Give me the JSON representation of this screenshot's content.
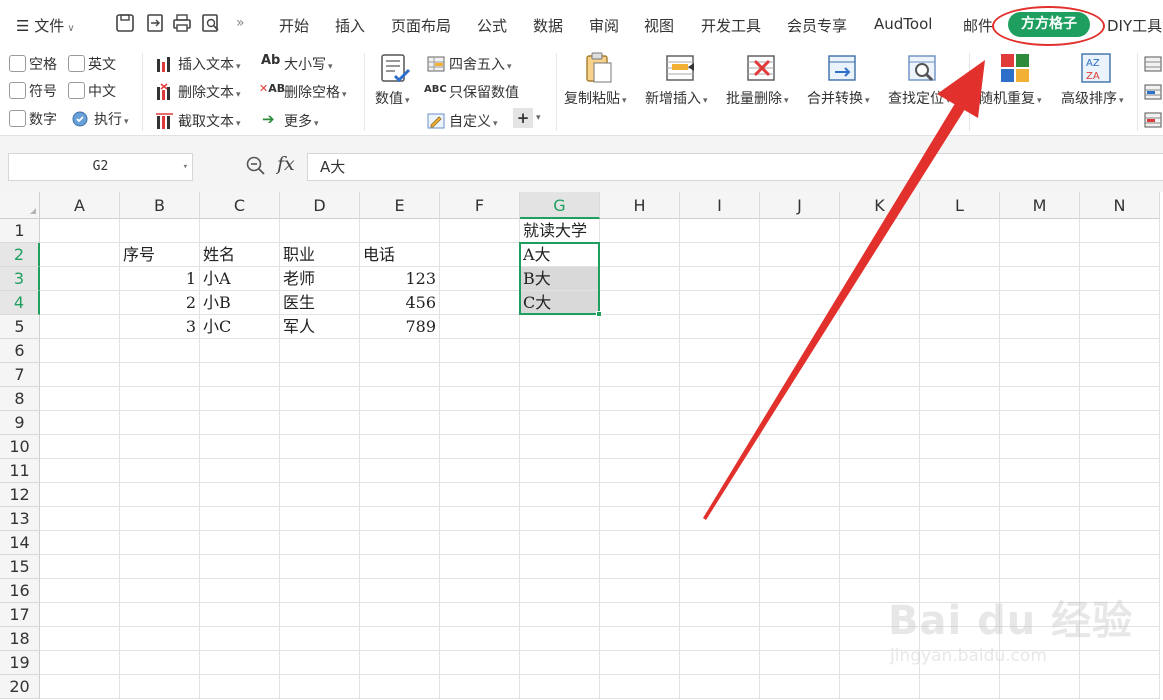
{
  "menu": {
    "file_label": "文件",
    "tabs": [
      "开始",
      "插入",
      "页面布局",
      "公式",
      "数据",
      "审阅",
      "视图",
      "开发工具",
      "会员专享",
      "AudTool",
      "邮件",
      "方方格子",
      "DIY工具箱"
    ],
    "active_tab": "方方格子"
  },
  "ribbon": {
    "checkboxes": [
      "空格",
      "英文",
      "符号",
      "中文",
      "数字"
    ],
    "exec_label": "执行",
    "text_tools": [
      "插入文本",
      "删除文本",
      "截取文本"
    ],
    "case_tools": [
      "大小写",
      "删除空格",
      "更多"
    ],
    "value_label": "数值",
    "round_tools": [
      "四舍五入",
      "只保留数值",
      "自定义"
    ],
    "plus_label": "+",
    "big_buttons": [
      "复制粘贴",
      "新增插入",
      "批量删除",
      "合并转换",
      "查找定位",
      "随机重复",
      "高级排序"
    ]
  },
  "formula": {
    "name_box": "G2",
    "fx": "fx",
    "content": "A大"
  },
  "sheet": {
    "columns": [
      "A",
      "B",
      "C",
      "D",
      "E",
      "F",
      "G",
      "H",
      "I",
      "J",
      "K",
      "L",
      "M",
      "N"
    ],
    "selected_column": "G",
    "rows": [
      "1",
      "2",
      "3",
      "4",
      "5",
      "6",
      "7",
      "8",
      "9",
      "10",
      "11",
      "12",
      "13",
      "14",
      "15",
      "16",
      "17",
      "18",
      "19",
      "20"
    ],
    "selected_rows": [
      "2",
      "3",
      "4"
    ],
    "cells": {
      "G1": "就读大学",
      "B2": "序号",
      "C2": "姓名",
      "D2": "职业",
      "E2": "电话",
      "G2": "A大",
      "B3": "1",
      "C3": "小A",
      "D3": "老师",
      "E3": "123",
      "G3": "B大",
      "B4": "2",
      "C4": "小B",
      "D4": "医生",
      "E4": "456",
      "G4": "C大",
      "B5": "3",
      "C5": "小C",
      "D5": "军人",
      "E5": "789"
    }
  },
  "colors": {
    "accent": "#1f9f5f",
    "annotation": "#e2312c"
  },
  "watermark": {
    "logo": "Bai du 经验",
    "url": "jingyan.baidu.com"
  }
}
